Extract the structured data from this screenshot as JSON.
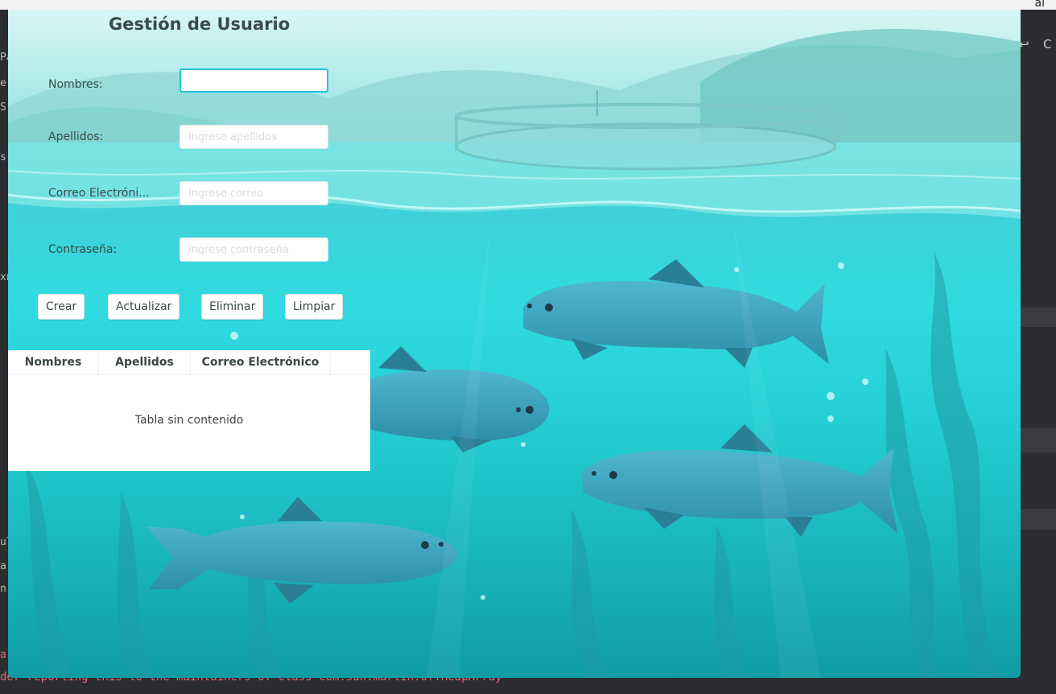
{
  "app": {
    "title": "Gestión de Usuario",
    "fields": [
      {
        "label": "Nombres:",
        "value": "",
        "placeholder": ""
      },
      {
        "label": "Apellidos:",
        "value": "",
        "placeholder": "ingrese apellidos"
      },
      {
        "label": "Correo Electróni...",
        "value": "",
        "placeholder": "ingrese correo"
      },
      {
        "label": "Contraseña:",
        "value": "",
        "placeholder": "ingrese contraseña"
      }
    ],
    "buttons": {
      "create": "Crear",
      "update": "Actualizar",
      "delete": "Eliminar",
      "clear": "Limpiar"
    },
    "table": {
      "columns": [
        "Nombres",
        "Apellidos",
        "Correo Electrónico"
      ],
      "empty_message": "Tabla sin contenido"
    }
  },
  "background_ide": {
    "left_fragments": [
      "Pa",
      "er",
      "S",
      "s",
      "xn",
      "ul",
      "a",
      "n",
      "a"
    ],
    "right_fragments": [
      "al",
      "C"
    ],
    "bottom_log": "der reporting this to the maintainers of class com.sun.marlin.OffHeapArray"
  },
  "colors": {
    "focus_border": "#26c2d8",
    "water": "#2fdbe0",
    "fish": "#3aa6bd"
  },
  "icons": [
    "close-icon",
    "undo-icon",
    "fish-illustration",
    "net-pen-illustration"
  ]
}
